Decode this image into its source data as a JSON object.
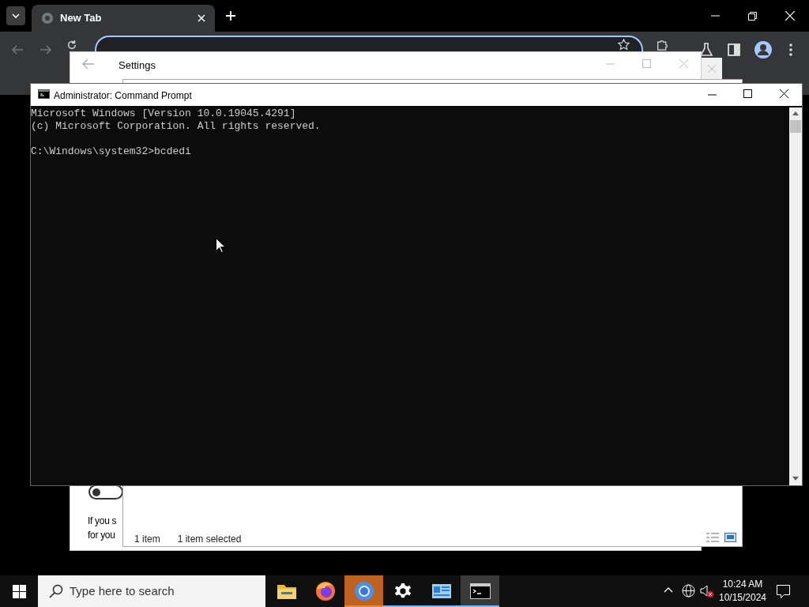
{
  "browser": {
    "tabs": [
      {
        "label": "New Tab",
        "selected": true
      }
    ]
  },
  "settings_window": {
    "title": "Settings",
    "toggle": {
      "on": false
    },
    "text_lines": [
      "If you s",
      "for you"
    ]
  },
  "explorer_window": {
    "status_items": [
      "1 item",
      "1 item selected"
    ]
  },
  "command_prompt": {
    "title": "Administrator: Command Prompt",
    "banner": [
      "Microsoft Windows [Version 10.0.19045.4291]",
      "(c) Microsoft Corporation. All rights reserved."
    ],
    "prompt": "C:\\Windows\\system32>bcdedi"
  },
  "taskbar": {
    "search": {
      "placeholder": "Type here to search"
    },
    "apps": [
      {
        "kind": "folder",
        "running": false,
        "flashing": false,
        "selected": false
      },
      {
        "kind": "firefox",
        "running": false,
        "flashing": false,
        "selected": false
      },
      {
        "kind": "chrome",
        "running": true,
        "flashing": true,
        "selected": false
      },
      {
        "kind": "gear",
        "running": true,
        "flashing": false,
        "selected": false
      },
      {
        "kind": "panel",
        "running": true,
        "flashing": false,
        "selected": false
      },
      {
        "kind": "terminal",
        "running": true,
        "flashing": false,
        "selected": true
      }
    ],
    "clock": {
      "time": "10:24 AM",
      "date": "10/15/2024"
    }
  }
}
